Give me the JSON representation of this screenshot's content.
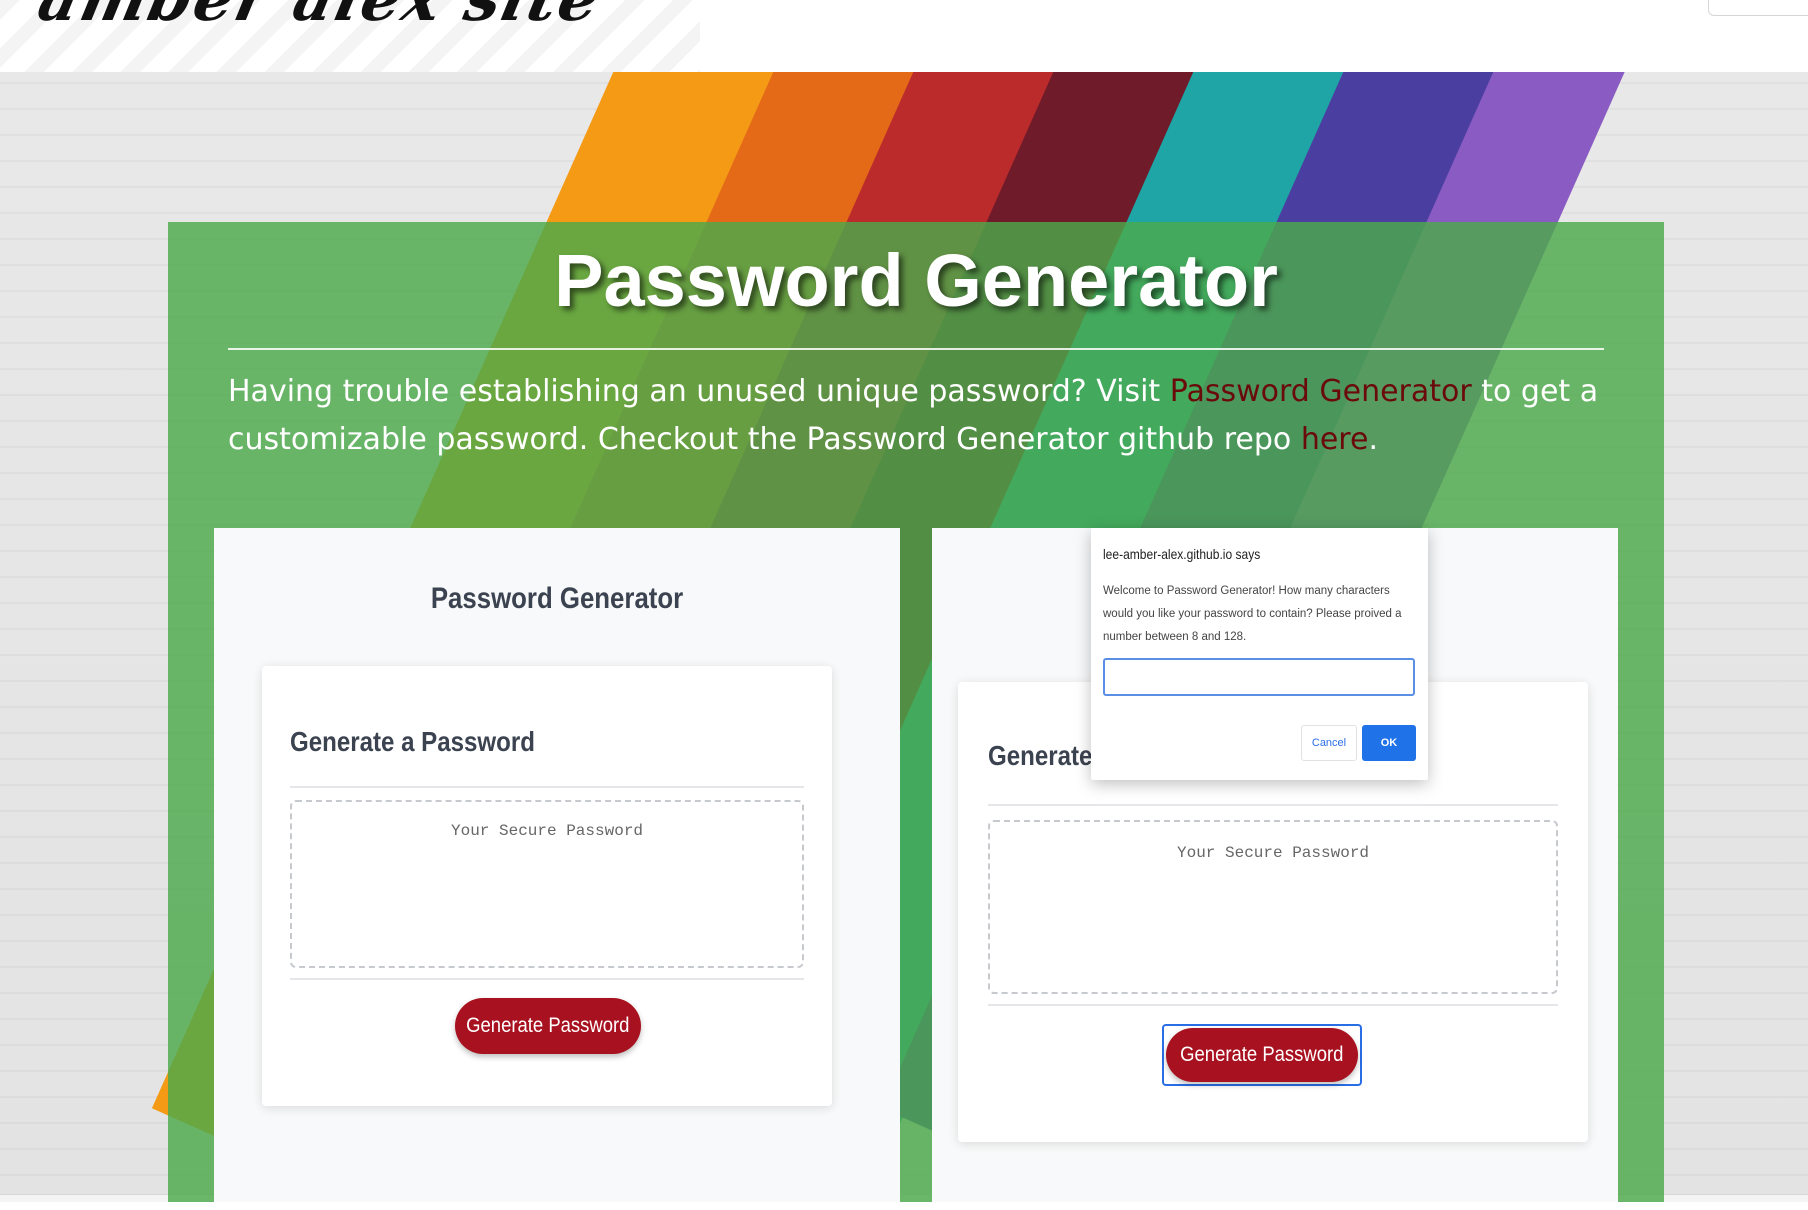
{
  "navbar": {
    "logo_text": "amber alex site"
  },
  "panel": {
    "title": "Password Generator",
    "description_part1": "Having trouble establishing an unused unique password? Visit ",
    "description_link1": "Password Generator",
    "description_part2": " to get a customizable password. Checkout the Password Generator github repo ",
    "description_link2": "here",
    "description_part3": "."
  },
  "left_shot": {
    "title": "Password Generator",
    "card_heading": "Generate a Password",
    "placeholder": "Your Secure Password",
    "button_label": "Generate Password"
  },
  "right_shot": {
    "card_heading": "Generate a Password",
    "placeholder": "Your Secure Password",
    "button_label": "Generate Password"
  },
  "dialog": {
    "title": "lee-amber-alex.github.io says",
    "message": "Welcome to Password Generator! How many characters would you like your password to contain? Please proived a number between 8 and 128.",
    "input_value": "",
    "cancel_label": "Cancel",
    "ok_label": "OK"
  },
  "colors": {
    "panel_green": "#4caa4c",
    "button_red": "#a8111f",
    "link_dark_red": "#6a0a0a",
    "dialog_blue": "#1f72e8"
  }
}
